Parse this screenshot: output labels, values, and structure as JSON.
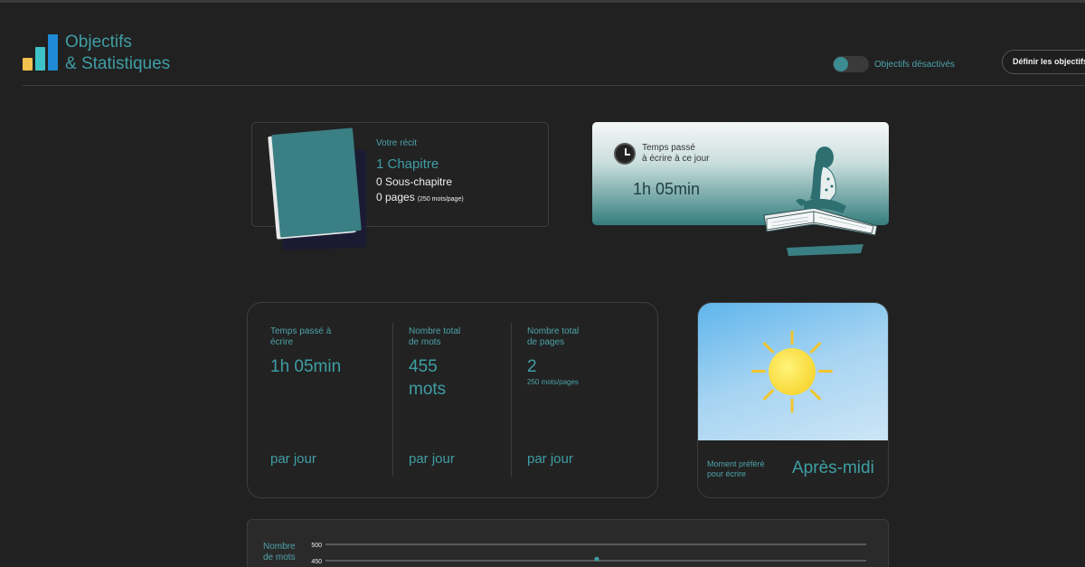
{
  "header": {
    "title_line1": "Objectifs",
    "title_line2": "& Statistiques",
    "toggle_label": "Objectifs désactivés",
    "define_button": "Définir les objectifs"
  },
  "recit": {
    "label": "Votre récit",
    "chapters": "1 Chapitre",
    "subchapters": "0 Sous-chapitre",
    "pages": "0 pages",
    "pages_note": "(250 mots/page)"
  },
  "time_card": {
    "label_line1": "Temps passé",
    "label_line2": "à écrire à ce jour",
    "value": "1h 05min"
  },
  "stats": [
    {
      "label_line1": "Temps passé à",
      "label_line2": "écrire",
      "value_line1": "1h 05min",
      "value_line2": "",
      "sub": "",
      "per": "par jour"
    },
    {
      "label_line1": "Nombre total",
      "label_line2": "de mots",
      "value_line1": "455",
      "value_line2": "mots",
      "sub": "",
      "per": "par jour"
    },
    {
      "label_line1": "Nombre total",
      "label_line2": "de pages",
      "value_line1": "2",
      "value_line2": "",
      "sub": "250 mots/pages",
      "per": "par jour"
    }
  ],
  "moment": {
    "label_line1": "Moment préféré",
    "label_line2": "pour écrire",
    "value": "Après-midi",
    "icon": "sun-icon"
  },
  "chart_data": {
    "type": "line",
    "ylabel": "Nombre de mots",
    "ylabel_line1": "Nombre",
    "ylabel_line2": "de mots",
    "y_ticks": [
      "500",
      "450"
    ],
    "ylim": [
      450,
      500
    ],
    "series": [
      {
        "values": [
          455
        ]
      }
    ]
  },
  "colors": {
    "accent": "#3f9ea5",
    "background": "#212121",
    "card_border": "#3d3d3d"
  }
}
